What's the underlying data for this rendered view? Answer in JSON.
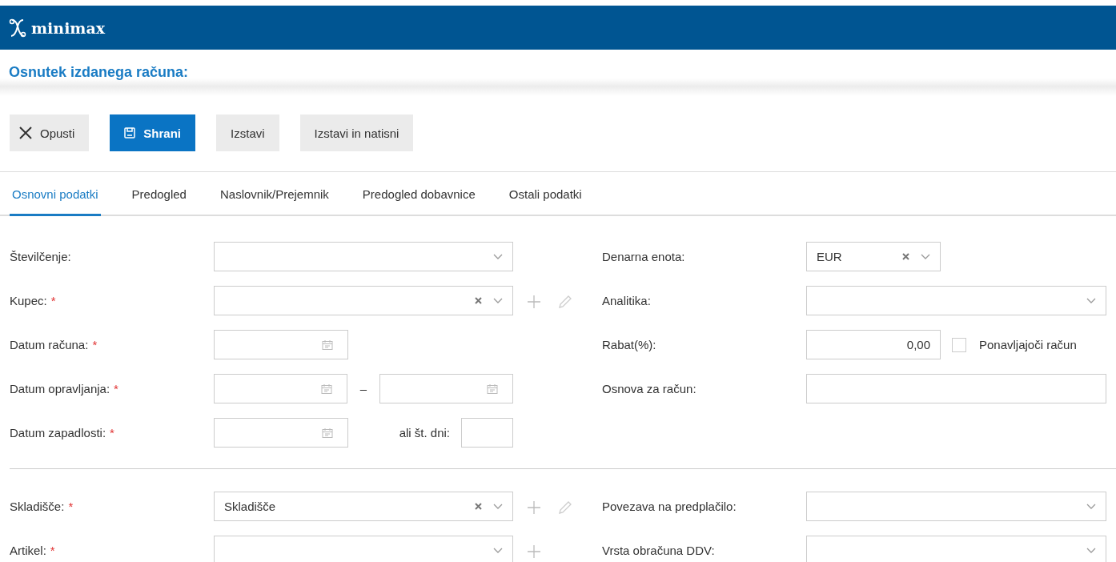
{
  "header": {
    "logo_text": "minimax"
  },
  "title": "Osnutek izdanega računa:",
  "toolbar": [
    {
      "label": "Opusti",
      "kind": "cancel"
    },
    {
      "label": "Shrani",
      "kind": "primary"
    },
    {
      "label": "Izstavi",
      "kind": "default"
    },
    {
      "label": "Izstavi in natisni",
      "kind": "default"
    }
  ],
  "tabs": [
    {
      "label": "Osnovni podatki",
      "selected": true
    },
    {
      "label": "Predogled",
      "selected": false
    },
    {
      "label": "Naslovnik/Prejemnik",
      "selected": false
    },
    {
      "label": "Predogled dobavnice",
      "selected": false
    },
    {
      "label": "Ostali podatki",
      "selected": false
    }
  ],
  "sections": [
    {
      "left": [
        {
          "label": "Številčenje:",
          "field": {
            "kind": "select",
            "icons": [
              {
                "kind": "dropdown"
              }
            ]
          }
        },
        {
          "label": "Kupec:",
          "marker": "*",
          "field": {
            "kind": "select",
            "icons": [
              {
                "kind": "clear"
              },
              {
                "kind": "dropdown"
              }
            ]
          },
          "actions": [
            {
              "kind": "add"
            },
            {
              "kind": "edit"
            }
          ]
        },
        {
          "label": "Datum računa:",
          "marker": "*",
          "field": {
            "kind": "date"
          }
        },
        {
          "label": "Datum opravljanja:",
          "marker": "*",
          "field": {
            "kind": "date_range",
            "separator": "–"
          }
        },
        {
          "label": "Datum zapadlosti:",
          "marker": "*",
          "field": {
            "kind": "date_days",
            "days_label": "ali št. dni:"
          }
        }
      ],
      "right": [
        {
          "label": "Denarna enota:",
          "field": {
            "kind": "short_select",
            "value": "EUR",
            "icons": [
              {
                "kind": "clear"
              },
              {
                "kind": "dropdown"
              }
            ]
          }
        },
        {
          "label": "Analitika:",
          "field": {
            "kind": "select",
            "icons": [
              {
                "kind": "dropdown"
              }
            ]
          }
        },
        {
          "label": "Rabat(%):",
          "field": {
            "kind": "number",
            "value": "0,00",
            "checkbox": {
              "label": "Ponavljajoči račun",
              "checked": false
            }
          }
        },
        {
          "label": "Osnova za račun:",
          "field": {
            "kind": "text"
          }
        }
      ]
    },
    {
      "left": [
        {
          "label": "Skladišče:",
          "marker": "*",
          "field": {
            "kind": "select",
            "value": "Skladišče",
            "icons": [
              {
                "kind": "clear"
              },
              {
                "kind": "dropdown"
              }
            ]
          },
          "actions": [
            {
              "kind": "add"
            },
            {
              "kind": "edit"
            }
          ]
        },
        {
          "label": "Artikel:",
          "marker": "*",
          "field": {
            "kind": "select",
            "icons": [
              {
                "kind": "dropdown"
              }
            ]
          },
          "actions": [
            {
              "kind": "add"
            }
          ]
        }
      ],
      "right": [
        {
          "label": "Povezava na predplačilo:",
          "field": {
            "kind": "select",
            "icons": [
              {
                "kind": "dropdown"
              }
            ]
          }
        },
        {
          "label": "Vrsta obračuna DDV:",
          "field": {
            "kind": "select",
            "icons": [
              {
                "kind": "dropdown"
              }
            ]
          }
        }
      ]
    }
  ]
}
